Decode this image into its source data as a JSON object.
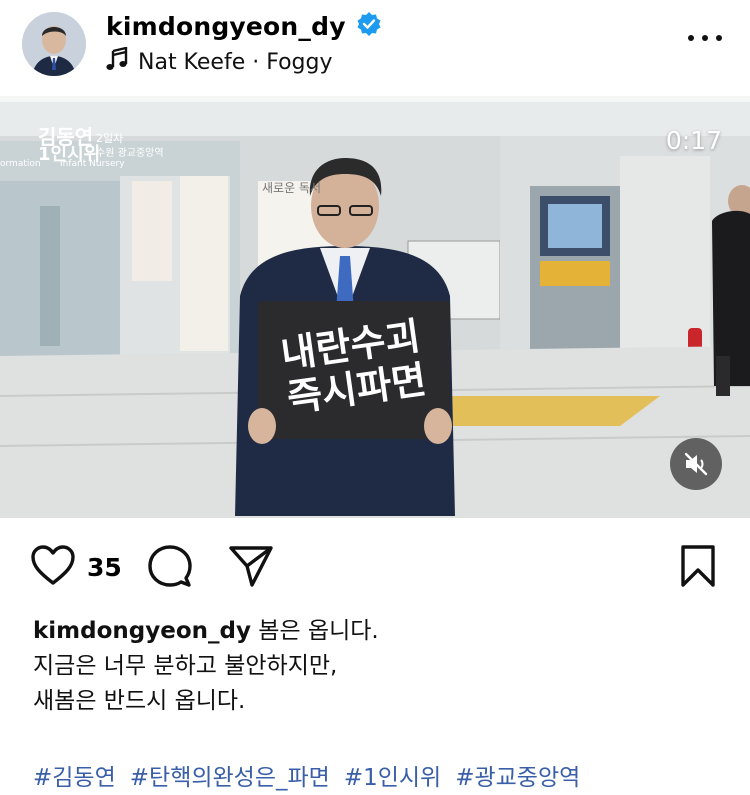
{
  "post": {
    "username": "kimdongyeon_dy",
    "verified": true,
    "music": "Nat Keefe · Foggy",
    "video_time": "0:17",
    "likes": "35",
    "sign_line_1": "내란수괴",
    "sign_line_2": "즉시파면",
    "caption_user": "kimdongyeon_dy",
    "caption_line_1": "봄은 옵니다.",
    "caption_line_2": "지금은 너무 분하고 불안하지만,",
    "caption_line_3": "새봄은 반드시 옵니다.",
    "hashtags": [
      "#김동연",
      "#탄핵의완성은_파면",
      "#1인시위",
      "#광교중앙역"
    ]
  },
  "scene_text": {
    "logo_name": "김동연",
    "logo_sub": "1인시위",
    "logo_tag": "2일차",
    "logo_loc": "수원 광교중앙역",
    "office_sign": "새로운 독서",
    "infant": "Infant Nursery",
    "info": "ormation"
  },
  "icons": {
    "verified": "verified-badge-icon",
    "music": "music-note-icon",
    "more": "more-options-icon",
    "like": "heart-icon",
    "comment": "comment-icon",
    "share": "share-icon",
    "save": "bookmark-icon",
    "mute": "speaker-muted-icon"
  },
  "colors": {
    "verified": "#1d9bf0",
    "hashtag": "#3a5fa8"
  }
}
